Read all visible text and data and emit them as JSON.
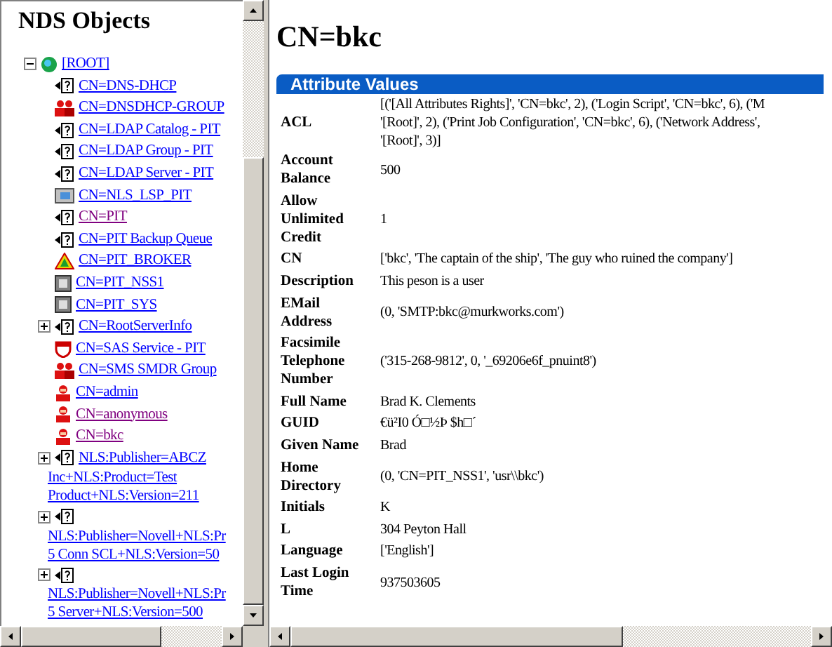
{
  "left_pane": {
    "title": "NDS Objects",
    "tree": [
      {
        "kind": "root",
        "lines": [
          "[ROOT]"
        ],
        "expanded": true,
        "visited": false,
        "children": [
          {
            "kind": "unknown",
            "lines": [
              "CN=DNS-DHCP"
            ],
            "visited": false
          },
          {
            "kind": "group",
            "lines": [
              "CN=DNSDHCP-GROUP"
            ],
            "visited": false
          },
          {
            "kind": "unknown",
            "lines": [
              "CN=LDAP Catalog - PIT"
            ],
            "visited": false
          },
          {
            "kind": "unknown",
            "lines": [
              "CN=LDAP Group - PIT"
            ],
            "visited": false
          },
          {
            "kind": "unknown",
            "lines": [
              "CN=LDAP Server - PIT"
            ],
            "visited": false
          },
          {
            "kind": "folder",
            "lines": [
              "CN=NLS_LSP_PIT"
            ],
            "visited": false
          },
          {
            "kind": "unknown",
            "lines": [
              "CN=PIT"
            ],
            "visited": true
          },
          {
            "kind": "unknown",
            "lines": [
              "CN=PIT Backup Queue"
            ],
            "visited": false
          },
          {
            "kind": "broker",
            "lines": [
              "CN=PIT_BROKER"
            ],
            "visited": false
          },
          {
            "kind": "volume",
            "lines": [
              "CN=PIT_NSS1"
            ],
            "visited": false
          },
          {
            "kind": "volume",
            "lines": [
              "CN=PIT_SYS"
            ],
            "visited": false
          },
          {
            "kind": "unknown",
            "lines": [
              "CN=RootServerInfo"
            ],
            "visited": false,
            "expanded": false
          },
          {
            "kind": "service",
            "lines": [
              "CN=SAS Service - PIT"
            ],
            "visited": false
          },
          {
            "kind": "group",
            "lines": [
              "CN=SMS SMDR Group"
            ],
            "visited": false
          },
          {
            "kind": "user",
            "lines": [
              "CN=admin"
            ],
            "visited": false
          },
          {
            "kind": "user",
            "lines": [
              "CN=anonymous"
            ],
            "visited": true
          },
          {
            "kind": "user",
            "lines": [
              "CN=bkc"
            ],
            "visited": true
          },
          {
            "kind": "unknown",
            "lines": [
              "NLS:Publisher=ABCZ",
              "Inc+NLS:Product=Test",
              "Product+NLS:Version=211"
            ],
            "visited": false,
            "expanded": false
          },
          {
            "kind": "unknown",
            "lines": [
              "NLS:Publisher=Novell+NLS:Pr",
              "5 Conn SCL+NLS:Version=50"
            ],
            "text_below_icon": true,
            "visited": false,
            "expanded": false
          },
          {
            "kind": "unknown",
            "lines": [
              "NLS:Publisher=Novell+NLS:Pr",
              "5 Server+NLS:Version=500"
            ],
            "text_below_icon": true,
            "visited": false,
            "expanded": false
          }
        ]
      }
    ]
  },
  "right_pane": {
    "title": "CN=bkc",
    "section": "Attribute Values",
    "attributes": [
      {
        "name": "ACL",
        "value": [
          "[('[All Attributes Rights]', 'CN=bkc', 2), ('Login Script', 'CN=bkc', 6), ('M",
          "'[Root]', 2), ('Print Job Configuration', 'CN=bkc', 6), ('Network Address',",
          "'[Root]', 3)]"
        ]
      },
      {
        "name": "Account Balance",
        "value": [
          "500"
        ]
      },
      {
        "name": "Allow Unlimited Credit",
        "value": [
          "1"
        ]
      },
      {
        "name": "CN",
        "value": [
          "['bkc', 'The captain of the ship', 'The guy who ruined the company']"
        ]
      },
      {
        "name": "Description",
        "value": [
          "This peson is a user"
        ]
      },
      {
        "name": "EMail Address",
        "value": [
          "(0, 'SMTP:bkc@murkworks.com')"
        ]
      },
      {
        "name": "Facsimile Telephone Number",
        "value": [
          "('315-268-9812', 0, '_69206e6f_pnuint8')"
        ]
      },
      {
        "name": "Full Name",
        "value": [
          "Brad K. Clements"
        ]
      },
      {
        "name": "GUID",
        "value": [
          "€ü²I0 Ó□½Þ $h□´"
        ]
      },
      {
        "name": "Given Name",
        "value": [
          "Brad"
        ]
      },
      {
        "name": "Home Directory",
        "value": [
          "(0, 'CN=PIT_NSS1', 'usr\\\\bkc')"
        ]
      },
      {
        "name": "Initials",
        "value": [
          "K"
        ]
      },
      {
        "name": "L",
        "value": [
          "304 Peyton Hall"
        ]
      },
      {
        "name": "Language",
        "value": [
          "['English']"
        ]
      },
      {
        "name": "Last Login Time",
        "value": [
          "937503605"
        ]
      }
    ]
  }
}
